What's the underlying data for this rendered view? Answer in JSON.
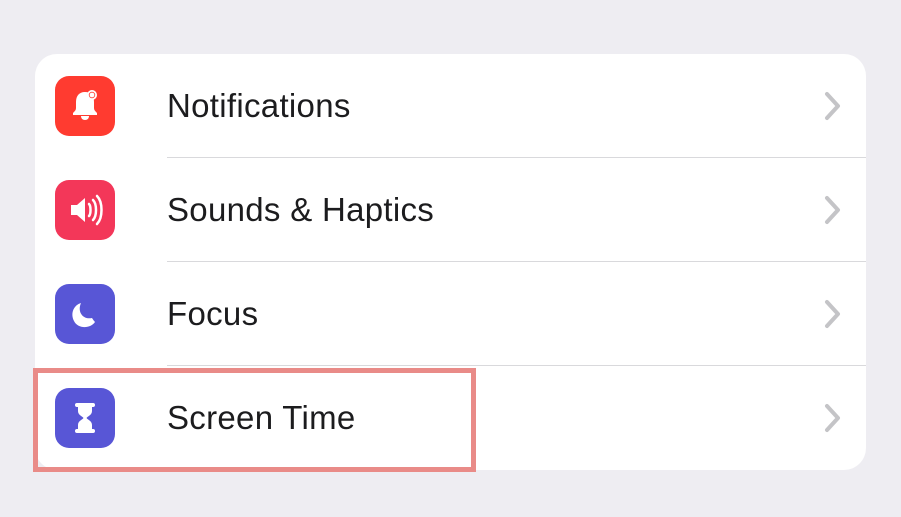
{
  "rows": [
    {
      "label": "Notifications",
      "icon": "bell-icon",
      "icon_bg": "#ff3b30"
    },
    {
      "label": "Sounds & Haptics",
      "icon": "speaker-icon",
      "icon_bg": "#f33759"
    },
    {
      "label": "Focus",
      "icon": "moon-icon",
      "icon_bg": "#5856d6"
    },
    {
      "label": "Screen Time",
      "icon": "hourglass-icon",
      "icon_bg": "#5856d6"
    }
  ],
  "highlight_index": 3,
  "colors": {
    "chevron": "#c4c4c7",
    "divider": "#d9d9dc"
  }
}
